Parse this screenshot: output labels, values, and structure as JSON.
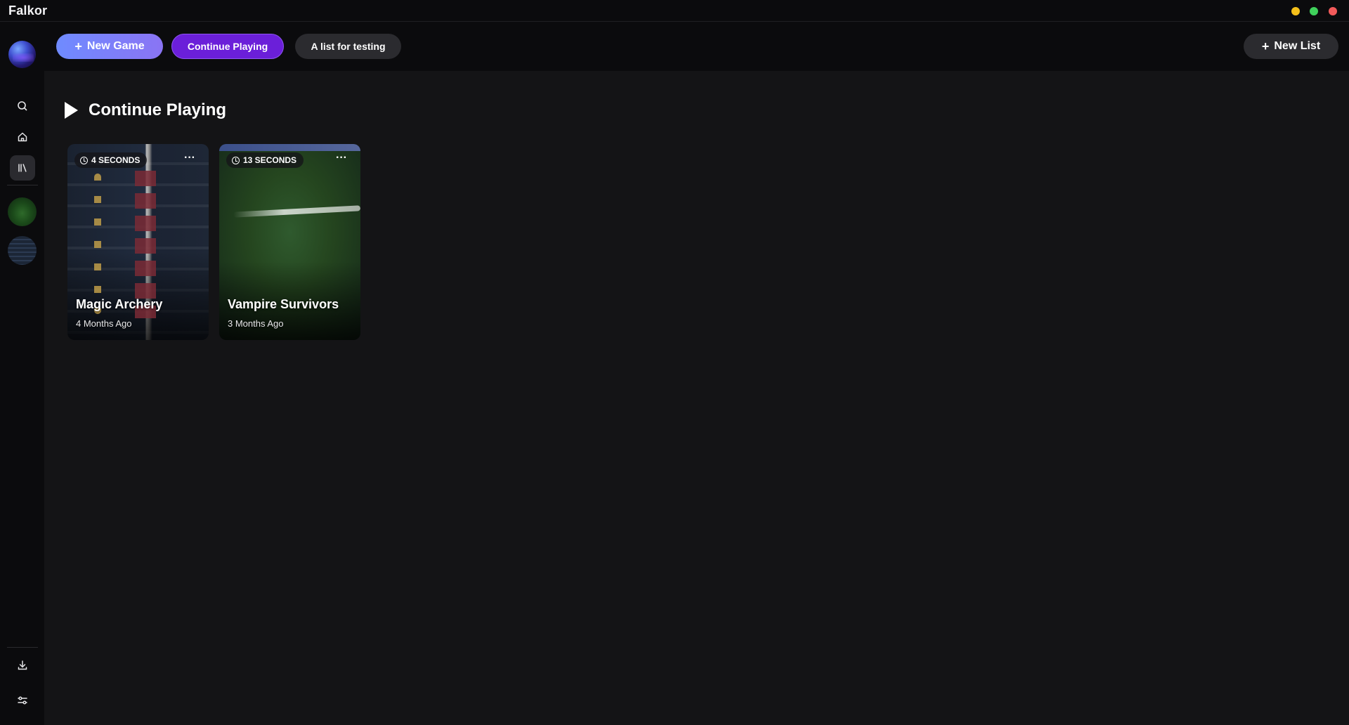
{
  "app": {
    "title": "Falkor",
    "window_controls": [
      {
        "name": "minimize",
        "color": "#f5c01a"
      },
      {
        "name": "maximize",
        "color": "#3fd15b"
      },
      {
        "name": "close",
        "color": "#f25a5a"
      }
    ]
  },
  "sidebar": {
    "profile_icon": "planet-avatar",
    "nav": [
      {
        "name": "search",
        "icon": "search-icon"
      },
      {
        "name": "home",
        "icon": "home-icon"
      },
      {
        "name": "library",
        "icon": "library-icon",
        "active": true
      }
    ],
    "games": [
      {
        "name": "Vampire Survivors",
        "icon": "vampire-survivors-thumb"
      },
      {
        "name": "Magic Archery",
        "icon": "magic-archery-thumb"
      }
    ],
    "bottom": [
      {
        "name": "downloads",
        "icon": "download-icon"
      },
      {
        "name": "settings",
        "icon": "sliders-icon"
      }
    ]
  },
  "topbar": {
    "new_game_label": "New Game",
    "continue_playing_label": "Continue Playing",
    "list_label": "A list for testing",
    "new_list_label": "New List",
    "accent": "#6b1fd9"
  },
  "main": {
    "section_title": "Continue Playing",
    "cards": [
      {
        "title": "Magic Archery",
        "playtime": "4 SECONDS",
        "last_played": "4 Months Ago"
      },
      {
        "title": "Vampire Survivors",
        "playtime": "13 SECONDS",
        "last_played": "3 Months Ago"
      }
    ]
  }
}
